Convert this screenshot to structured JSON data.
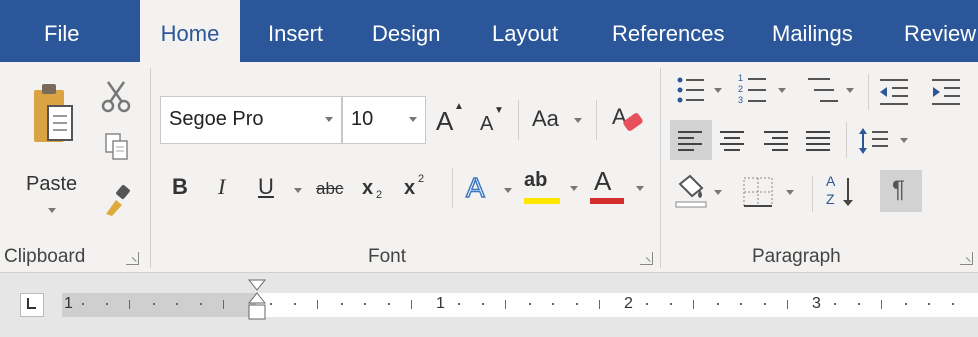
{
  "tabs": {
    "file": "File",
    "home": "Home",
    "insert": "Insert",
    "design": "Design",
    "layout": "Layout",
    "references": "References",
    "mailings": "Mailings",
    "review": "Review"
  },
  "clipboard": {
    "paste_label": "Paste",
    "group_label": "Clipboard"
  },
  "font": {
    "font_name": "Segoe Pro",
    "font_size": "10",
    "grow_label": "A",
    "shrink_label": "A",
    "case_label": "Aa",
    "bold": "B",
    "italic": "I",
    "underline": "U",
    "strike": "abc",
    "subscript_base": "x",
    "subscript_mark": "2",
    "superscript_base": "x",
    "superscript_mark": "2",
    "effects_label": "A",
    "highlight_label": "ab",
    "font_color_label": "A",
    "group_label": "Font",
    "highlight_color": "#ffe600",
    "font_color": "#d42e2e"
  },
  "paragraph": {
    "group_label": "Paragraph",
    "sort_top": "A",
    "sort_bottom": "Z",
    "pilcrow": "¶",
    "numbering_1": "1",
    "numbering_2": "2",
    "numbering_3": "3"
  },
  "ruler": {
    "numbers": [
      "1",
      "1",
      "2",
      "3"
    ]
  },
  "colors": {
    "accent": "#2b579a",
    "ribbon_bg": "#f3f2f1"
  }
}
